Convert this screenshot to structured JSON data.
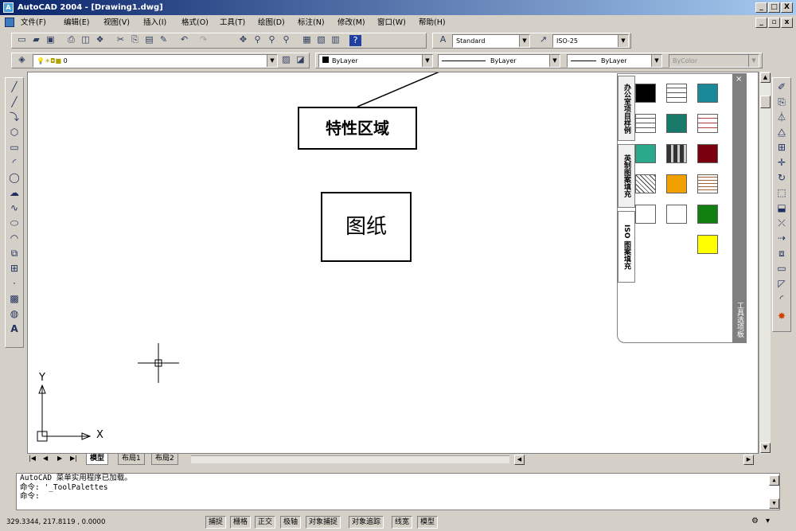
{
  "window": {
    "title": "AutoCAD 2004 - [Drawing1.dwg]",
    "min_label": "_",
    "max_label": "□",
    "close_label": "X"
  },
  "menu": [
    "文件(F)",
    "编辑(E)",
    "视图(V)",
    "插入(I)",
    "格式(O)",
    "工具(T)",
    "绘图(D)",
    "标注(N)",
    "修改(M)",
    "窗口(W)",
    "帮助(H)"
  ],
  "toolbar": {
    "text_style": "Standard",
    "dim_style": "ISO-25",
    "layer": "0",
    "color": "ByLayer",
    "linetype": "ByLayer",
    "lineweight": "ByLayer",
    "plot_style": "ByColor"
  },
  "annotations": {
    "properties_area": "特性区域",
    "drawing": "图纸"
  },
  "palette": {
    "tabs": [
      "办公室项目样例",
      "英制图案填充",
      "ISO 图案填充"
    ],
    "title": "工具选项板",
    "swatch_colors": [
      "#000000",
      "pattern-brick",
      "#1a8a9a",
      "pattern-brick",
      "#1a7a6a",
      "pattern-brick-red",
      "#2aaa8a",
      "pattern-grid",
      "#7a0010",
      "pattern-hatch",
      "#f0a000",
      "pattern-wood",
      "pattern-corner",
      "pattern-wave",
      "#108010",
      "#ffff00"
    ]
  },
  "ucs": {
    "x_label": "X",
    "y_label": "Y"
  },
  "layout_tabs": [
    "模型",
    "布局1",
    "布局2"
  ],
  "command_lines": [
    "AutoCAD 菜单实用程序已加载。",
    "命令: '_ToolPalettes",
    "命令:"
  ],
  "status": {
    "coords": "329.3344,  217.8119 , 0.0000",
    "buttons": [
      "捕捉",
      "栅格",
      "正交",
      "极轴",
      "对象捕捉",
      "对象追踪",
      "线宽",
      "模型"
    ]
  },
  "colors": {
    "title_start": "#0a246a",
    "title_end": "#a6caf0",
    "chrome": "#d4d0c8"
  }
}
